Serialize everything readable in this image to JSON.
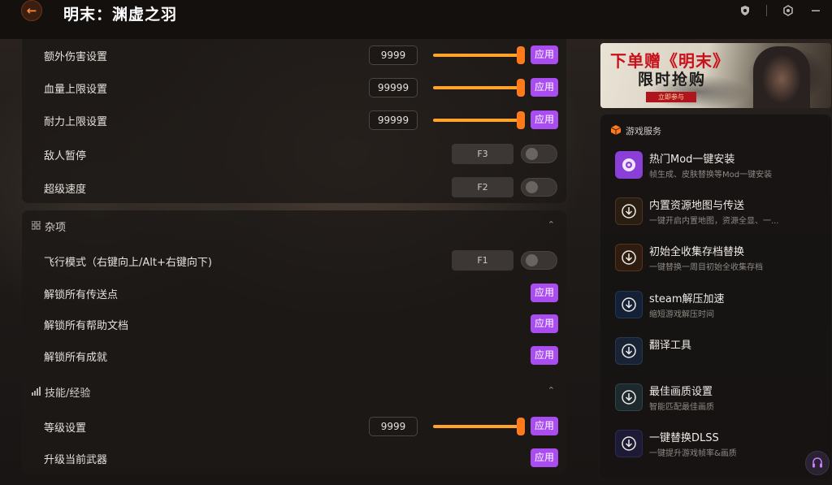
{
  "header": {
    "title": "明末：渊虚之羽"
  },
  "colors": {
    "accent": "#ff8a3a",
    "apply_button": "#a94cf0",
    "slider": "#ffa32a"
  },
  "section1": {
    "rows": [
      {
        "label": "额外伤害设置",
        "value": "9999",
        "action": "应用"
      },
      {
        "label": "血量上限设置",
        "value": "99999",
        "action": "应用"
      },
      {
        "label": "耐力上限设置",
        "value": "99999",
        "action": "应用"
      },
      {
        "label": "敌人暂停",
        "hotkey": "F3",
        "enabled": false
      },
      {
        "label": "超级速度",
        "hotkey": "F2",
        "enabled": false
      }
    ]
  },
  "misc": {
    "title": "杂项",
    "rows": [
      {
        "label": "飞行模式（右键向上/Alt+右键向下)",
        "hotkey": "F1",
        "enabled": false
      },
      {
        "label": "解锁所有传送点",
        "action": "应用"
      },
      {
        "label": "解锁所有帮助文档",
        "action": "应用"
      },
      {
        "label": "解锁所有成就",
        "action": "应用"
      }
    ]
  },
  "skills": {
    "title": "技能/经验",
    "rows": [
      {
        "label": "等级设置",
        "value": "9999",
        "action": "应用"
      },
      {
        "label": "升级当前武器",
        "action": "应用"
      }
    ]
  },
  "banner": {
    "line1": "下单赠《明末》",
    "line2": "限时抢购",
    "cta": "立即参与"
  },
  "services": {
    "title": "游戏服务",
    "items": [
      {
        "title": "热门Mod一键安装",
        "subtitle": "帧生成、皮肤替换等Mod一键安装",
        "icon": "mod-icon"
      },
      {
        "title": "内置资源地图与传送",
        "subtitle": "一键开启内置地图，资源全显、一...",
        "icon": "download-icon"
      },
      {
        "title": "初始全收集存档替换",
        "subtitle": "一键替换一周目初始全收集存档",
        "icon": "download-icon"
      },
      {
        "title": "steam解压加速",
        "subtitle": "缩短游戏解压时间",
        "icon": "download-icon"
      },
      {
        "title": "翻译工具",
        "subtitle": "",
        "icon": "download-icon"
      },
      {
        "title": "最佳画质设置",
        "subtitle": "智能匹配最佳画质",
        "icon": "download-icon"
      },
      {
        "title": "一键替换DLSS",
        "subtitle": "一键提升游戏帧率&画质",
        "icon": "download-icon"
      }
    ]
  }
}
